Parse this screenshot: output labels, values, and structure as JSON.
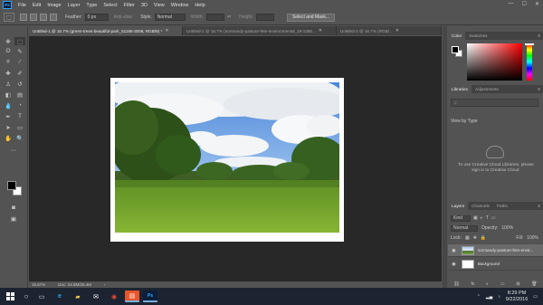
{
  "app": {
    "logo_text": "Ps",
    "menu": [
      "File",
      "Edit",
      "Image",
      "Layer",
      "Type",
      "Select",
      "Filter",
      "3D",
      "View",
      "Window",
      "Help"
    ],
    "window_controls": [
      "—",
      "☐",
      "✕"
    ]
  },
  "options_bar": {
    "feather_label": "Feather:",
    "feather_value": "0 px",
    "antialias_label": "Anti-alias",
    "style_label": "Style:",
    "style_value": "Normal",
    "width_label": "Width:",
    "height_label": "Height:",
    "select_mask_label": "Select and Mask..."
  },
  "tabs": [
    {
      "label": "Untitled-1 @ 16.7% (green-trees-beautiful-park_51195-3008, RGB/8) *",
      "close": "✕"
    },
    {
      "label": "Untitled-1 @ 16.7% (normandy-pasture-fete-environmental_19-1386...",
      "close": "✕"
    },
    {
      "label": "Untitled-2 @ 16.7% (RGB/...",
      "close": "✕"
    }
  ],
  "status_bar": {
    "zoom": "16.67%",
    "doc": "Doc: 24.9M/26.4M"
  },
  "color_panel": {
    "tabs": [
      "Color",
      "Swatches"
    ]
  },
  "libraries_panel": {
    "tabs": [
      "Libraries",
      "Adjustments"
    ],
    "view_by": "View by Type",
    "message": "To use Creative Cloud Libraries, please sign in to Creative Cloud."
  },
  "layers_panel": {
    "tabs": [
      "Layers",
      "Channels",
      "Paths"
    ],
    "kind_label": "Kind",
    "blend_mode": "Normal",
    "opacity_label": "Opacity:",
    "opacity_value": "100%",
    "lock_label": "Lock:",
    "fill_label": "Fill:",
    "fill_value": "100%",
    "layers": [
      {
        "name": "normandy-pasture-fete-envir...",
        "selected": true
      },
      {
        "name": "Background",
        "selected": false
      }
    ],
    "footer_icons": [
      "fx",
      "◐",
      "▭",
      "⊞",
      "🗑"
    ]
  },
  "taskbar": {
    "time": "8:29 PM",
    "date": "9/22/2016",
    "apps": [
      "file-explorer",
      "edge",
      "folder",
      "mail",
      "chrome",
      "paint",
      "photoshop"
    ]
  }
}
